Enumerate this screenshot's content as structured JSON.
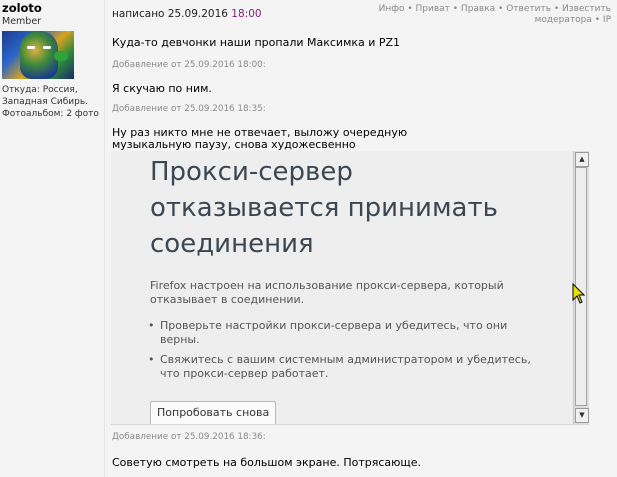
{
  "user": {
    "name": "zoloto",
    "title": "Member",
    "info_lines": [
      "Откуда: Россия,",
      "Западная Сибирь.",
      "Фотоальбом: 2 фото"
    ]
  },
  "post": {
    "written_prefix": "написано 25.09.2016",
    "written_time": "18:00",
    "actions_line1": "Инфо • Приват • Правка • Ответить • Известить",
    "actions_line2": "модератора • IP",
    "message1": "Куда-то девчонки наши пропали Максимка и PZ1",
    "added1": "Добавление от 25.09.2016 18:00:",
    "message2": "Я скучаю по ним.",
    "added2": "Добавление от 25.09.2016 18:35:",
    "message3": "Ну раз никто мне не отвечает, выложу очередную музыкальную паузу, снова художесвенно психологическую.",
    "added3": "Добавление от 25.09.2016 18:36:",
    "message4": "Советую смотреть на большом экране. Потрясающе."
  },
  "embed": {
    "title": "Прокси-сервер отказывается принимать соединения",
    "description": "Firefox настроен на использование прокси-сервера, который отказывает в соединении.",
    "bullets": [
      "Проверьте настройки прокси-сервера и убедитесь, что они верны.",
      "Свяжитесь с вашим системным администратором и убедитесь, что прокси-сервер работает."
    ],
    "retry_label": "Попробовать снова"
  }
}
